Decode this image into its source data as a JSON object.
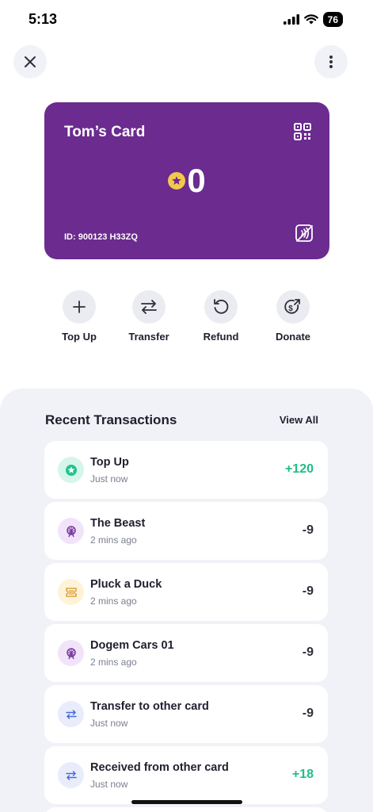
{
  "status": {
    "time": "5:13",
    "battery": "76"
  },
  "card": {
    "title": "Tom’s Card",
    "balance": "0",
    "id_text": "ID: 900123 H33ZQ",
    "color": "#6b2b8f"
  },
  "actions": [
    {
      "label": "Top Up",
      "icon": "plus-icon"
    },
    {
      "label": "Transfer",
      "icon": "swap-arrows-icon"
    },
    {
      "label": "Refund",
      "icon": "undo-icon"
    },
    {
      "label": "Donate",
      "icon": "donate-icon"
    }
  ],
  "transactions": {
    "title": "Recent Transactions",
    "view_all": "View All",
    "items": [
      {
        "name": "Top Up",
        "time": "Just now",
        "amount": "+120",
        "icon": "coin-star-icon",
        "amount_color": "#1fbf84"
      },
      {
        "name": "The Beast",
        "time": "2 mins ago",
        "amount": "-9",
        "icon": "ferris-wheel-icon",
        "amount_color": "#2d2f3a"
      },
      {
        "name": "Pluck a Duck",
        "time": "2 mins ago",
        "amount": "-9",
        "icon": "ticket-icon",
        "amount_color": "#2d2f3a"
      },
      {
        "name": "Dogem Cars 01",
        "time": "2 mins ago",
        "amount": "-9",
        "icon": "ferris-wheel-icon",
        "amount_color": "#2d2f3a"
      },
      {
        "name": "Transfer to other card",
        "time": "Just now",
        "amount": "-9",
        "icon": "swap-arrows-icon",
        "amount_color": "#2d2f3a"
      },
      {
        "name": "Received from other card",
        "time": "Just now",
        "amount": "+18",
        "icon": "swap-arrows-icon",
        "amount_color": "#1fbf84"
      }
    ]
  }
}
